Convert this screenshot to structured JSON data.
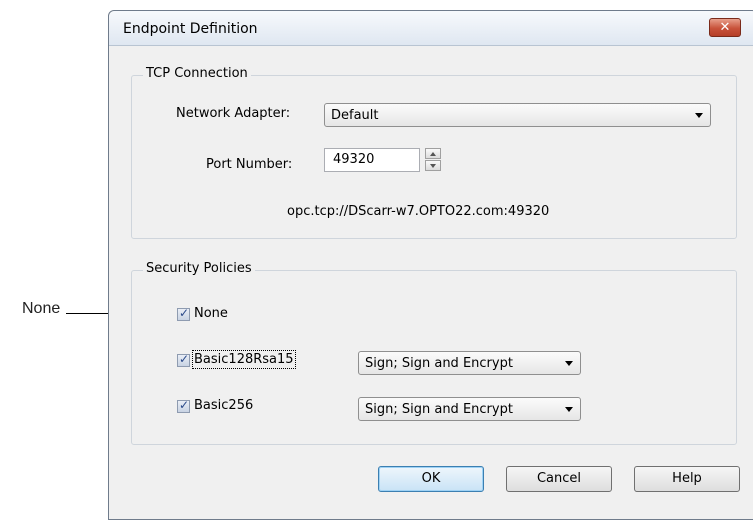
{
  "callout": {
    "label": "None"
  },
  "dialog": {
    "title": "Endpoint Definition",
    "close_glyph": "✕"
  },
  "tcp": {
    "legend": "TCP Connection",
    "network_adapter_label": "Network Adapter:",
    "network_adapter_value": "Default",
    "port_label": "Port Number:",
    "port_value": "49320",
    "endpoint_url": "opc.tcp://DScarr-w7.OPTO22.com:49320"
  },
  "security": {
    "legend": "Security Policies",
    "policies": [
      {
        "label": "None",
        "checked": true
      },
      {
        "label": "Basic128Rsa15",
        "checked": true,
        "mode": "Sign; Sign and Encrypt"
      },
      {
        "label": "Basic256",
        "checked": true,
        "mode": "Sign; Sign and Encrypt"
      }
    ]
  },
  "buttons": {
    "ok": "OK",
    "cancel": "Cancel",
    "help": "Help"
  },
  "icons": {
    "close": "close-icon",
    "dropdown": "chevron-down-icon",
    "spin_up": "arrow-up-icon",
    "spin_down": "arrow-down-icon",
    "check": "checkmark-icon"
  }
}
